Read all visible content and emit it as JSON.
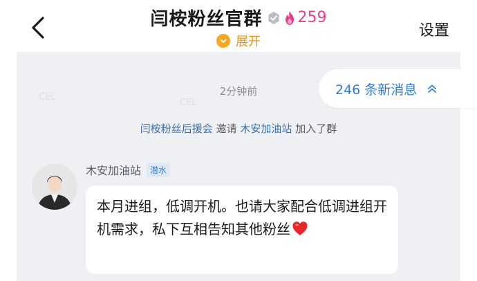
{
  "header": {
    "title": "闫桉粉丝官群",
    "member_count": "259",
    "expand_label": "展开",
    "settings_label": "设置"
  },
  "chat": {
    "time_label": "2分钟前",
    "new_messages": "246 条新消息",
    "notice": {
      "inviter": "闫桉粉丝后援会",
      "action": "邀请",
      "invitee": "木安加油站",
      "suffix": "加入了群"
    },
    "message": {
      "sender": "木安加油站",
      "badge": "潜水",
      "text": "本月进组，低调开机。也请大家配合低调进组开机需求，私下互相告知其他粉丝"
    }
  },
  "colors": {
    "chat_background": "#eff0f3",
    "link_blue": "#3d6fa8",
    "new_message_blue": "#2f7fd6",
    "expand_orange": "#f5a623",
    "member_pink": "#e53f8a"
  },
  "icons": [
    "back-chevron-icon",
    "verified-badge-icon",
    "flame-icon",
    "chevron-down-icon",
    "double-chevron-up-icon",
    "heart-icon"
  ]
}
